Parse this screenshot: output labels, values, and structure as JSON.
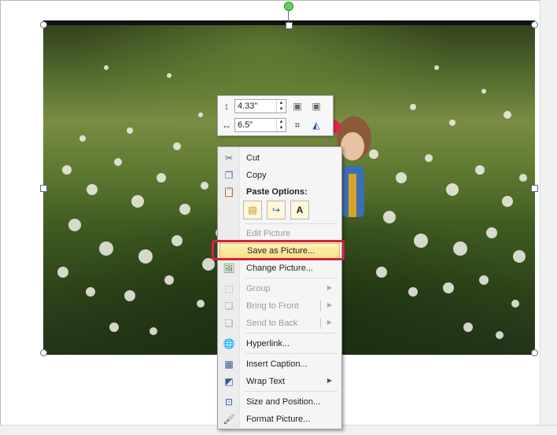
{
  "mini_toolbar": {
    "height_value": "4.33\"",
    "width_value": "6.5\"",
    "height_icon": "shape-height-icon",
    "width_icon": "shape-width-icon",
    "bring_forward_icon": "bring-forward-icon",
    "send_backward_icon": "send-backward-icon",
    "crop_icon": "crop-icon",
    "text_wrap_icon": "wrap-text-icon"
  },
  "context_menu": {
    "cut": "Cut",
    "copy": "Copy",
    "paste_options": "Paste Options:",
    "paste_keep_label": "A",
    "edit_picture": "Edit Picture",
    "save_as_picture": "Save as Picture...",
    "change_picture": "Change Picture...",
    "group": "Group",
    "bring_to_front": "Bring to Front",
    "send_to_back": "Send to Back",
    "hyperlink": "Hyperlink...",
    "insert_caption": "Insert Caption...",
    "wrap_text": "Wrap Text",
    "size_and_position": "Size and Position...",
    "format_picture": "Format Picture..."
  },
  "colors": {
    "highlight": "#fbe08a",
    "annotation_outline": "#d0253c",
    "selection_handle": "#5a6b7c",
    "rotate_handle": "#5fd35a"
  }
}
